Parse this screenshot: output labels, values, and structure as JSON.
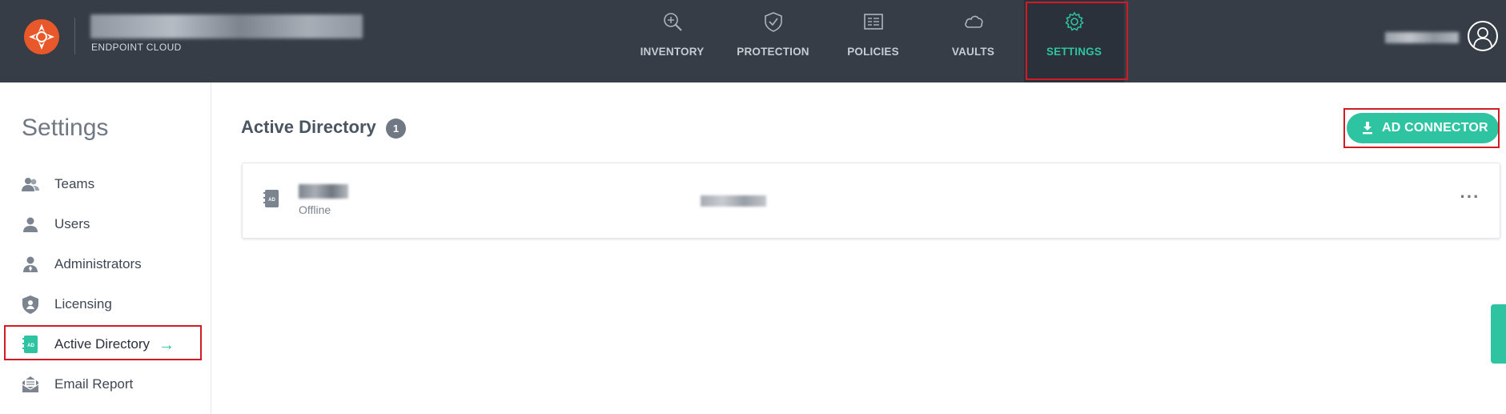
{
  "header": {
    "brand_subtitle": "ENDPOINT CLOUD",
    "nav": [
      {
        "label": "INVENTORY",
        "icon": "inventory-search-icon"
      },
      {
        "label": "PROTECTION",
        "icon": "shield-check-icon"
      },
      {
        "label": "POLICIES",
        "icon": "policies-list-icon"
      },
      {
        "label": "VAULTS",
        "icon": "cloud-icon"
      },
      {
        "label": "SETTINGS",
        "icon": "gear-icon",
        "active": true
      }
    ]
  },
  "sidebar": {
    "title": "Settings",
    "items": [
      {
        "label": "Teams",
        "icon": "teams-icon"
      },
      {
        "label": "Users",
        "icon": "user-icon"
      },
      {
        "label": "Administrators",
        "icon": "administrator-icon"
      },
      {
        "label": "Licensing",
        "icon": "licensing-shield-icon"
      },
      {
        "label": "Active Directory",
        "icon": "active-directory-icon",
        "active": true
      },
      {
        "label": "Email Report",
        "icon": "email-icon"
      }
    ]
  },
  "main": {
    "title": "Active Directory",
    "count": "1",
    "ad_connector_label": "AD CONNECTOR",
    "directories": [
      {
        "status": "Offline"
      }
    ]
  },
  "colors": {
    "topbar": "#363d47",
    "accent": "#2ec4a2",
    "highlight": "#d01c24"
  }
}
